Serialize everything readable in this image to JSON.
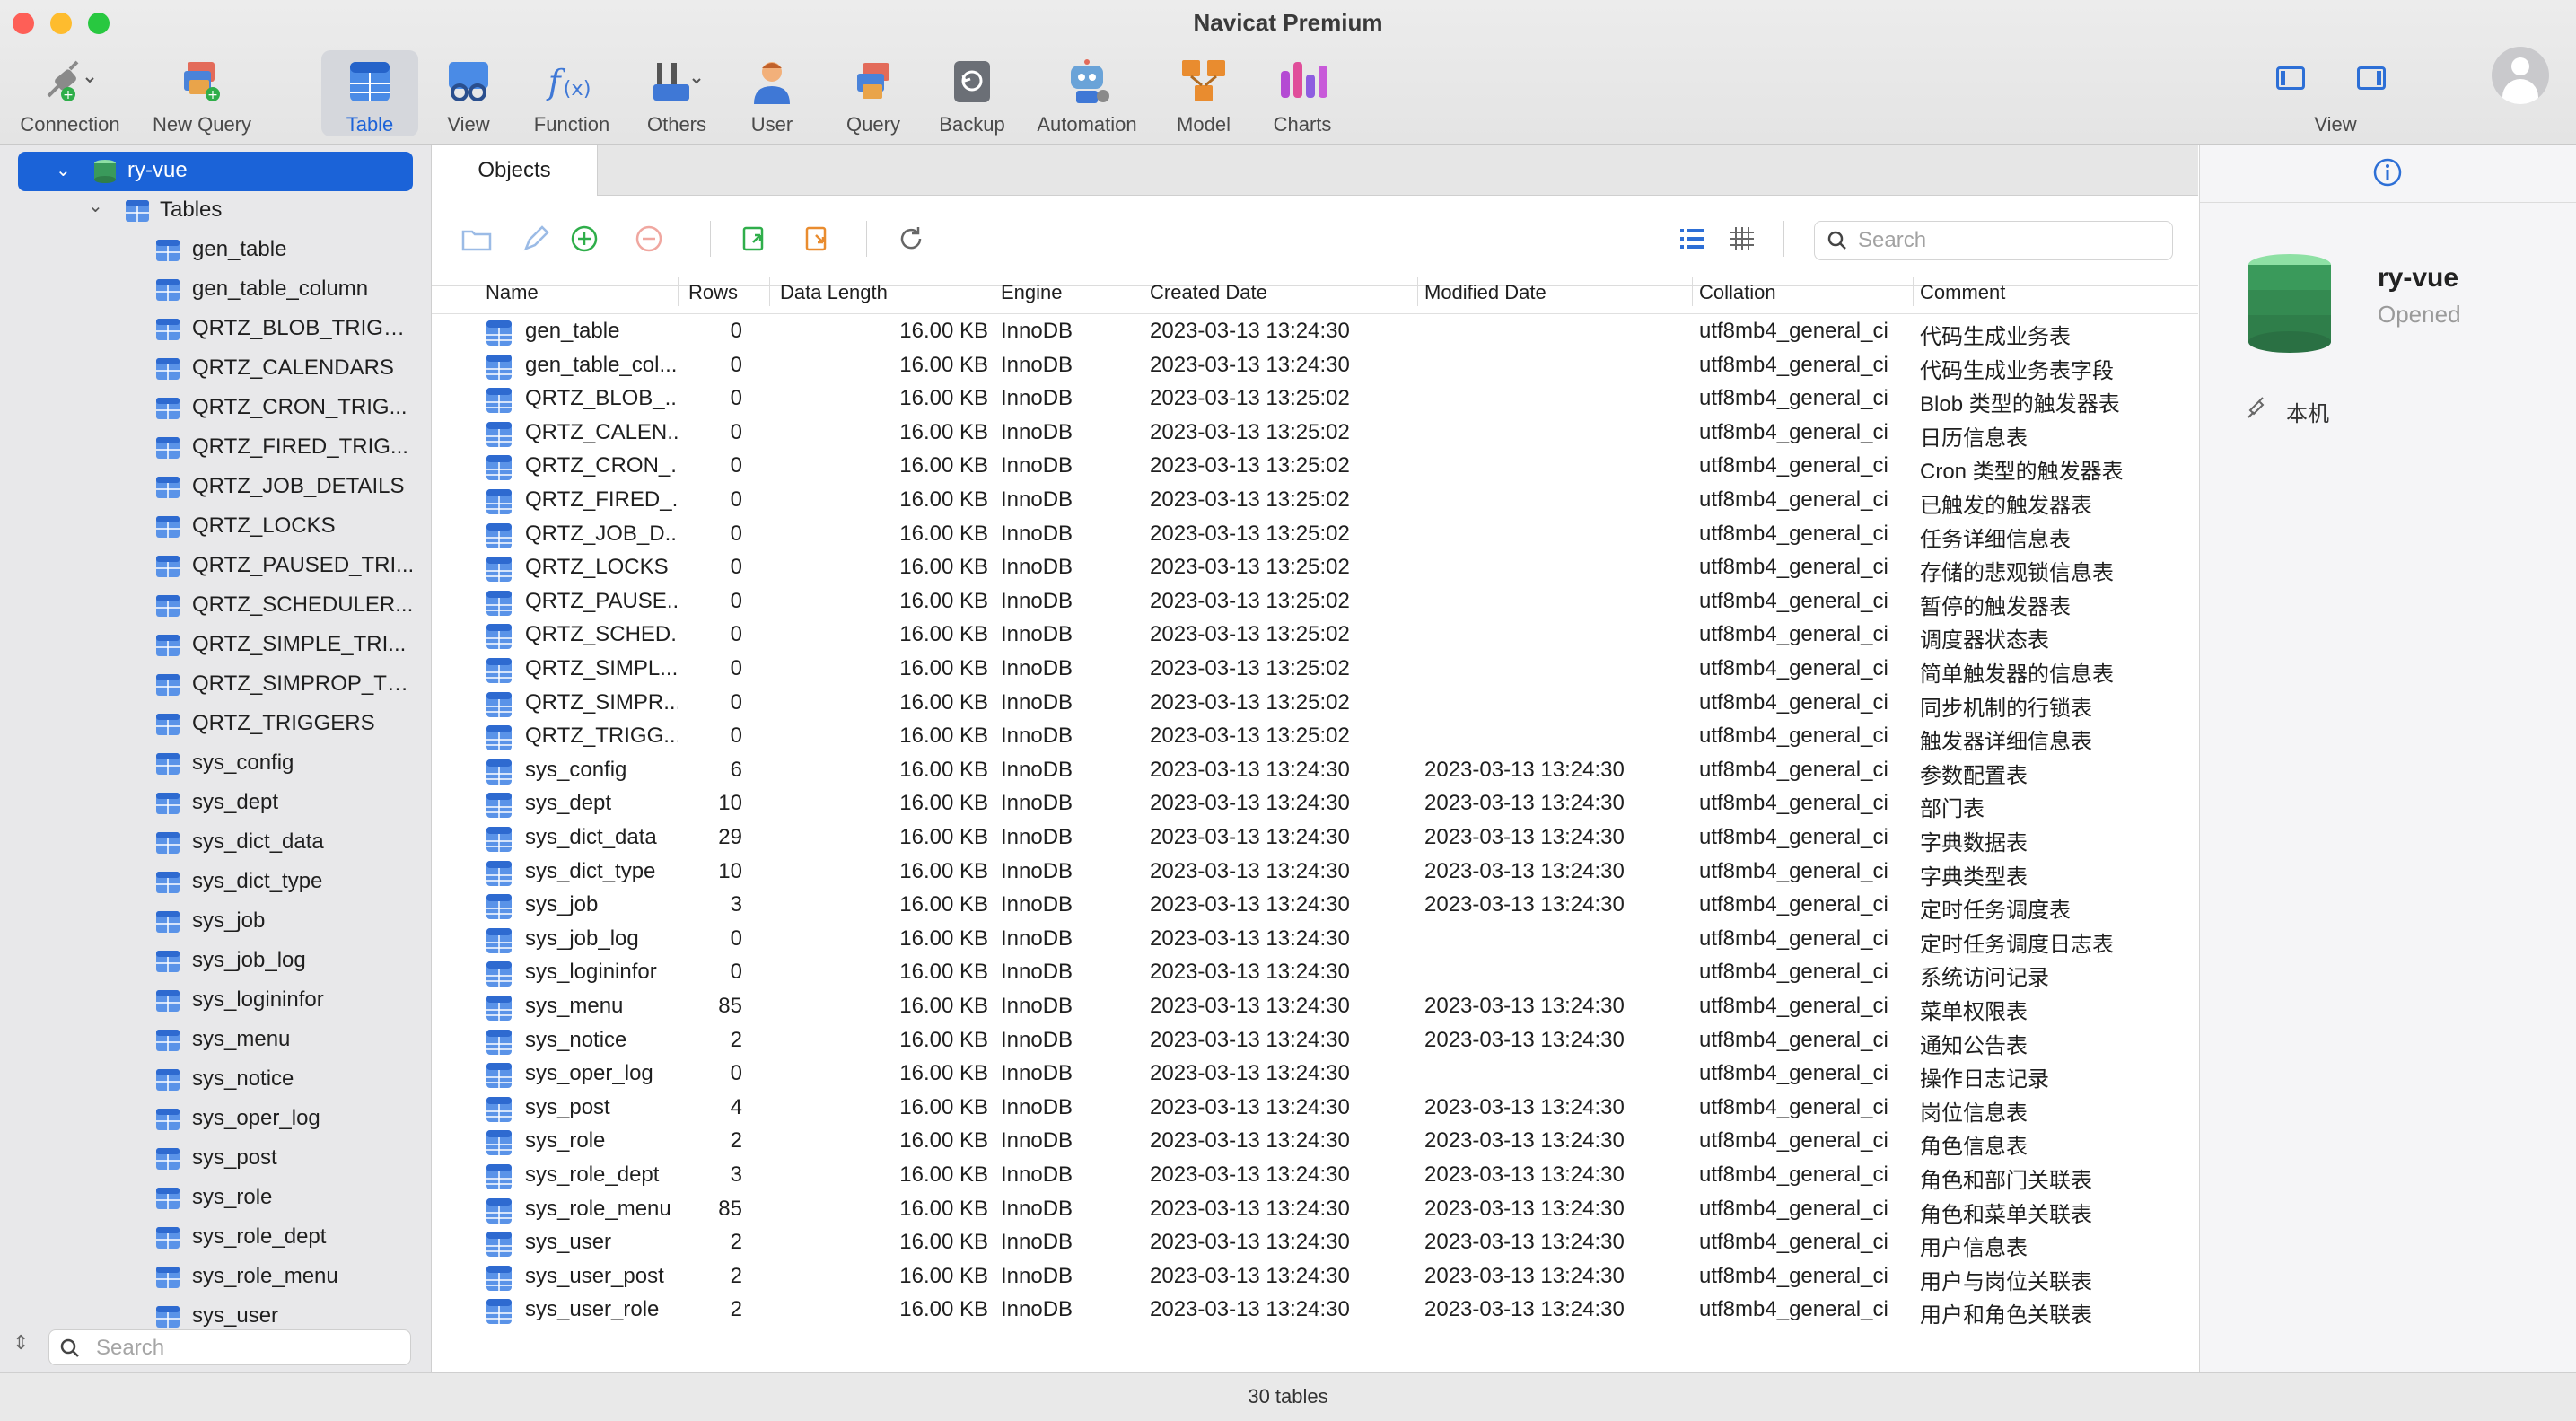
{
  "window": {
    "title": "Navicat Premium"
  },
  "toolbar": {
    "connection": "Connection",
    "new_query": "New Query",
    "table": "Table",
    "view": "View",
    "function": "Function",
    "others": "Others",
    "user": "User",
    "query": "Query",
    "backup": "Backup",
    "automation": "Automation",
    "model": "Model",
    "charts": "Charts",
    "view_right": "View"
  },
  "sidebar": {
    "database": "ry-vue",
    "tables_label": "Tables",
    "tables": [
      "gen_table",
      "gen_table_column",
      "QRTZ_BLOB_TRIGG...",
      "QRTZ_CALENDARS",
      "QRTZ_CRON_TRIG...",
      "QRTZ_FIRED_TRIG...",
      "QRTZ_JOB_DETAILS",
      "QRTZ_LOCKS",
      "QRTZ_PAUSED_TRI...",
      "QRTZ_SCHEDULER...",
      "QRTZ_SIMPLE_TRI...",
      "QRTZ_SIMPROP_TR...",
      "QRTZ_TRIGGERS",
      "sys_config",
      "sys_dept",
      "sys_dict_data",
      "sys_dict_type",
      "sys_job",
      "sys_job_log",
      "sys_logininfor",
      "sys_menu",
      "sys_notice",
      "sys_oper_log",
      "sys_post",
      "sys_role",
      "sys_role_dept",
      "sys_role_menu",
      "sys_user"
    ],
    "search_placeholder": "Search"
  },
  "tabs": {
    "objects": "Objects"
  },
  "objects": {
    "search_placeholder": "Search",
    "columns": [
      "Name",
      "Rows",
      "Data Length",
      "Engine",
      "Created Date",
      "Modified Date",
      "Collation",
      "Comment"
    ],
    "rows": [
      {
        "name": "gen_table",
        "rows": "0",
        "length": "16.00 KB",
        "engine": "InnoDB",
        "created": "2023-03-13 13:24:30",
        "modified": "",
        "collation": "utf8mb4_general_ci",
        "comment": "代码生成业务表"
      },
      {
        "name": "gen_table_col...",
        "rows": "0",
        "length": "16.00 KB",
        "engine": "InnoDB",
        "created": "2023-03-13 13:24:30",
        "modified": "",
        "collation": "utf8mb4_general_ci",
        "comment": "代码生成业务表字段"
      },
      {
        "name": "QRTZ_BLOB_...",
        "rows": "0",
        "length": "16.00 KB",
        "engine": "InnoDB",
        "created": "2023-03-13 13:25:02",
        "modified": "",
        "collation": "utf8mb4_general_ci",
        "comment": "Blob 类型的触发器表"
      },
      {
        "name": "QRTZ_CALEN...",
        "rows": "0",
        "length": "16.00 KB",
        "engine": "InnoDB",
        "created": "2023-03-13 13:25:02",
        "modified": "",
        "collation": "utf8mb4_general_ci",
        "comment": "日历信息表"
      },
      {
        "name": "QRTZ_CRON_...",
        "rows": "0",
        "length": "16.00 KB",
        "engine": "InnoDB",
        "created": "2023-03-13 13:25:02",
        "modified": "",
        "collation": "utf8mb4_general_ci",
        "comment": "Cron 类型的触发器表"
      },
      {
        "name": "QRTZ_FIRED_...",
        "rows": "0",
        "length": "16.00 KB",
        "engine": "InnoDB",
        "created": "2023-03-13 13:25:02",
        "modified": "",
        "collation": "utf8mb4_general_ci",
        "comment": "已触发的触发器表"
      },
      {
        "name": "QRTZ_JOB_D...",
        "rows": "0",
        "length": "16.00 KB",
        "engine": "InnoDB",
        "created": "2023-03-13 13:25:02",
        "modified": "",
        "collation": "utf8mb4_general_ci",
        "comment": "任务详细信息表"
      },
      {
        "name": "QRTZ_LOCKS",
        "rows": "0",
        "length": "16.00 KB",
        "engine": "InnoDB",
        "created": "2023-03-13 13:25:02",
        "modified": "",
        "collation": "utf8mb4_general_ci",
        "comment": "存储的悲观锁信息表"
      },
      {
        "name": "QRTZ_PAUSE...",
        "rows": "0",
        "length": "16.00 KB",
        "engine": "InnoDB",
        "created": "2023-03-13 13:25:02",
        "modified": "",
        "collation": "utf8mb4_general_ci",
        "comment": "暂停的触发器表"
      },
      {
        "name": "QRTZ_SCHED...",
        "rows": "0",
        "length": "16.00 KB",
        "engine": "InnoDB",
        "created": "2023-03-13 13:25:02",
        "modified": "",
        "collation": "utf8mb4_general_ci",
        "comment": "调度器状态表"
      },
      {
        "name": "QRTZ_SIMPL...",
        "rows": "0",
        "length": "16.00 KB",
        "engine": "InnoDB",
        "created": "2023-03-13 13:25:02",
        "modified": "",
        "collation": "utf8mb4_general_ci",
        "comment": "简单触发器的信息表"
      },
      {
        "name": "QRTZ_SIMPR...",
        "rows": "0",
        "length": "16.00 KB",
        "engine": "InnoDB",
        "created": "2023-03-13 13:25:02",
        "modified": "",
        "collation": "utf8mb4_general_ci",
        "comment": "同步机制的行锁表"
      },
      {
        "name": "QRTZ_TRIGG...",
        "rows": "0",
        "length": "16.00 KB",
        "engine": "InnoDB",
        "created": "2023-03-13 13:25:02",
        "modified": "",
        "collation": "utf8mb4_general_ci",
        "comment": "触发器详细信息表"
      },
      {
        "name": "sys_config",
        "rows": "6",
        "length": "16.00 KB",
        "engine": "InnoDB",
        "created": "2023-03-13 13:24:30",
        "modified": "2023-03-13 13:24:30",
        "collation": "utf8mb4_general_ci",
        "comment": "参数配置表"
      },
      {
        "name": "sys_dept",
        "rows": "10",
        "length": "16.00 KB",
        "engine": "InnoDB",
        "created": "2023-03-13 13:24:30",
        "modified": "2023-03-13 13:24:30",
        "collation": "utf8mb4_general_ci",
        "comment": "部门表"
      },
      {
        "name": "sys_dict_data",
        "rows": "29",
        "length": "16.00 KB",
        "engine": "InnoDB",
        "created": "2023-03-13 13:24:30",
        "modified": "2023-03-13 13:24:30",
        "collation": "utf8mb4_general_ci",
        "comment": "字典数据表"
      },
      {
        "name": "sys_dict_type",
        "rows": "10",
        "length": "16.00 KB",
        "engine": "InnoDB",
        "created": "2023-03-13 13:24:30",
        "modified": "2023-03-13 13:24:30",
        "collation": "utf8mb4_general_ci",
        "comment": "字典类型表"
      },
      {
        "name": "sys_job",
        "rows": "3",
        "length": "16.00 KB",
        "engine": "InnoDB",
        "created": "2023-03-13 13:24:30",
        "modified": "2023-03-13 13:24:30",
        "collation": "utf8mb4_general_ci",
        "comment": "定时任务调度表"
      },
      {
        "name": "sys_job_log",
        "rows": "0",
        "length": "16.00 KB",
        "engine": "InnoDB",
        "created": "2023-03-13 13:24:30",
        "modified": "",
        "collation": "utf8mb4_general_ci",
        "comment": "定时任务调度日志表"
      },
      {
        "name": "sys_logininfor",
        "rows": "0",
        "length": "16.00 KB",
        "engine": "InnoDB",
        "created": "2023-03-13 13:24:30",
        "modified": "",
        "collation": "utf8mb4_general_ci",
        "comment": "系统访问记录"
      },
      {
        "name": "sys_menu",
        "rows": "85",
        "length": "16.00 KB",
        "engine": "InnoDB",
        "created": "2023-03-13 13:24:30",
        "modified": "2023-03-13 13:24:30",
        "collation": "utf8mb4_general_ci",
        "comment": "菜单权限表"
      },
      {
        "name": "sys_notice",
        "rows": "2",
        "length": "16.00 KB",
        "engine": "InnoDB",
        "created": "2023-03-13 13:24:30",
        "modified": "2023-03-13 13:24:30",
        "collation": "utf8mb4_general_ci",
        "comment": "通知公告表"
      },
      {
        "name": "sys_oper_log",
        "rows": "0",
        "length": "16.00 KB",
        "engine": "InnoDB",
        "created": "2023-03-13 13:24:30",
        "modified": "",
        "collation": "utf8mb4_general_ci",
        "comment": "操作日志记录"
      },
      {
        "name": "sys_post",
        "rows": "4",
        "length": "16.00 KB",
        "engine": "InnoDB",
        "created": "2023-03-13 13:24:30",
        "modified": "2023-03-13 13:24:30",
        "collation": "utf8mb4_general_ci",
        "comment": "岗位信息表"
      },
      {
        "name": "sys_role",
        "rows": "2",
        "length": "16.00 KB",
        "engine": "InnoDB",
        "created": "2023-03-13 13:24:30",
        "modified": "2023-03-13 13:24:30",
        "collation": "utf8mb4_general_ci",
        "comment": "角色信息表"
      },
      {
        "name": "sys_role_dept",
        "rows": "3",
        "length": "16.00 KB",
        "engine": "InnoDB",
        "created": "2023-03-13 13:24:30",
        "modified": "2023-03-13 13:24:30",
        "collation": "utf8mb4_general_ci",
        "comment": "角色和部门关联表"
      },
      {
        "name": "sys_role_menu",
        "rows": "85",
        "length": "16.00 KB",
        "engine": "InnoDB",
        "created": "2023-03-13 13:24:30",
        "modified": "2023-03-13 13:24:30",
        "collation": "utf8mb4_general_ci",
        "comment": "角色和菜单关联表"
      },
      {
        "name": "sys_user",
        "rows": "2",
        "length": "16.00 KB",
        "engine": "InnoDB",
        "created": "2023-03-13 13:24:30",
        "modified": "2023-03-13 13:24:30",
        "collation": "utf8mb4_general_ci",
        "comment": "用户信息表"
      },
      {
        "name": "sys_user_post",
        "rows": "2",
        "length": "16.00 KB",
        "engine": "InnoDB",
        "created": "2023-03-13 13:24:30",
        "modified": "2023-03-13 13:24:30",
        "collation": "utf8mb4_general_ci",
        "comment": "用户与岗位关联表"
      },
      {
        "name": "sys_user_role",
        "rows": "2",
        "length": "16.00 KB",
        "engine": "InnoDB",
        "created": "2023-03-13 13:24:30",
        "modified": "2023-03-13 13:24:30",
        "collation": "utf8mb4_general_ci",
        "comment": "用户和角色关联表"
      }
    ]
  },
  "info": {
    "name": "ry-vue",
    "status": "Opened",
    "connection": "本机"
  },
  "status_bar": {
    "text": "30 tables"
  },
  "colors": {
    "accent": "#1b63d8",
    "sidebar_bg": "#e8e8ea",
    "db_green": "#3a9a5b"
  }
}
